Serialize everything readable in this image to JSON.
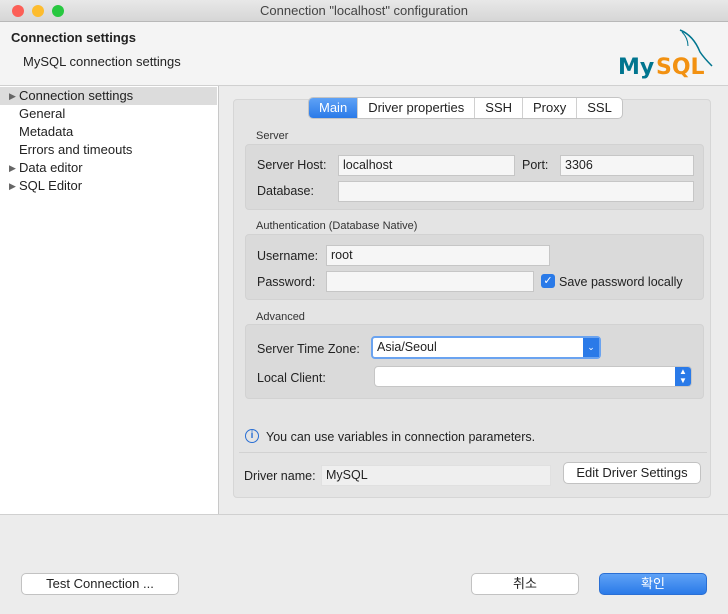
{
  "window": {
    "title": "Connection \"localhost\" configuration"
  },
  "header": {
    "title": "Connection settings",
    "subtitle": "MySQL connection settings",
    "logo_text": "MySQL"
  },
  "sidebar": {
    "items": [
      {
        "label": "Connection settings",
        "expandable": true,
        "selected": true
      },
      {
        "label": "General"
      },
      {
        "label": "Metadata"
      },
      {
        "label": "Errors and timeouts"
      },
      {
        "label": "Data editor",
        "expandable": true
      },
      {
        "label": "SQL Editor",
        "expandable": true
      }
    ]
  },
  "tabs": [
    "Main",
    "Driver properties",
    "SSH",
    "Proxy",
    "SSL"
  ],
  "server": {
    "group": "Server",
    "host_label": "Server Host:",
    "host": "localhost",
    "port_label": "Port:",
    "port": "3306",
    "database_label": "Database:",
    "database": ""
  },
  "auth": {
    "group": "Authentication (Database Native)",
    "username_label": "Username:",
    "username": "root",
    "password_label": "Password:",
    "password": "",
    "save_password_label": "Save password locally",
    "save_password": true
  },
  "advanced": {
    "group": "Advanced",
    "timezone_label": "Server Time Zone:",
    "timezone": "Asia/Seoul",
    "local_client_label": "Local Client:",
    "local_client": ""
  },
  "info": "You can use variables in connection parameters.",
  "driver": {
    "label": "Driver name:",
    "value": "MySQL",
    "edit_button": "Edit Driver Settings"
  },
  "footer": {
    "test_button": "Test Connection ...",
    "cancel_button": "취소",
    "ok_button": "확인"
  },
  "colors": {
    "accent": "#2a7ae8",
    "logo_blue": "#00758f",
    "logo_orange": "#f29111"
  }
}
